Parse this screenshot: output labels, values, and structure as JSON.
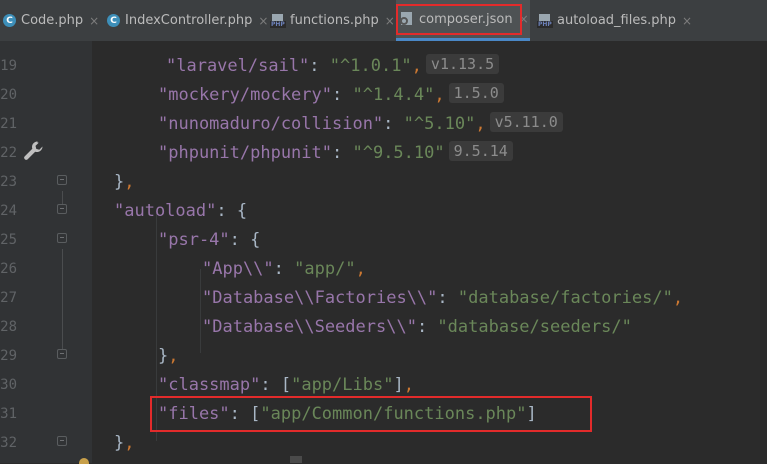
{
  "tabs": [
    {
      "label": "Code.php",
      "icon": "c-class-icon",
      "close": "×"
    },
    {
      "label": "IndexController.php",
      "icon": "c-class-icon",
      "close": "×"
    },
    {
      "label": "functions.php",
      "icon": "php-file-icon",
      "close": "×"
    },
    {
      "label": "composer.json",
      "icon": "json-file-icon",
      "close": "×",
      "active": true
    },
    {
      "label": "autoload_files.php",
      "icon": "php-file-icon",
      "close": "×"
    }
  ],
  "line_numbers": [
    "19",
    "20",
    "21",
    "22",
    "23",
    "24",
    "25",
    "26",
    "27",
    "28",
    "29",
    "30",
    "31",
    "32"
  ],
  "code": {
    "l19": {
      "key": "\"laravel/sail\"",
      "colon": ": ",
      "val": "\"^1.0.1\"",
      "comma": ",",
      "hint": "v1.13.5"
    },
    "l20": {
      "key": "\"mockery/mockery\"",
      "colon": ": ",
      "val": "\"^1.4.4\"",
      "comma": ",",
      "hint": "1.5.0"
    },
    "l21": {
      "key": "\"nunomaduro/collision\"",
      "colon": ": ",
      "val": "\"^5.10\"",
      "comma": ",",
      "hint": "v5.11.0"
    },
    "l22": {
      "key": "\"phpunit/phpunit\"",
      "colon": ": ",
      "val": "\"^9.5.10\"",
      "hint": "9.5.14"
    },
    "l23": {
      "close": "}",
      "comma": ","
    },
    "l24": {
      "key": "\"autoload\"",
      "colon": ": ",
      "open": "{"
    },
    "l25": {
      "key": "\"psr-4\"",
      "colon": ": ",
      "open": "{"
    },
    "l26": {
      "key": "\"App\\\\\"",
      "colon": ": ",
      "val": "\"app/\"",
      "comma": ","
    },
    "l27": {
      "key": "\"Database\\\\Factories\\\\\"",
      "colon": ": ",
      "val": "\"database/factories/\"",
      "comma": ","
    },
    "l28": {
      "key": "\"Database\\\\Seeders\\\\\"",
      "colon": ": ",
      "val": "\"database/seeders/\""
    },
    "l29": {
      "close": "}",
      "comma": ","
    },
    "l30": {
      "key": "\"classmap\"",
      "colon": ": ",
      "lb": "[",
      "val": "\"app/Libs\"",
      "rb": "]",
      "comma": ","
    },
    "l31": {
      "key": "\"files\"",
      "colon": ": ",
      "lb": "[",
      "val": "\"app/Common/functions.php\"",
      "rb": "]"
    },
    "l32": {
      "close": "}",
      "comma": ","
    }
  },
  "colors": {
    "background": "#2b2b2b",
    "json_key": "#9876aa",
    "string": "#6a8759",
    "punctuation": "#cc7832",
    "highlight": "#e32b2b"
  }
}
